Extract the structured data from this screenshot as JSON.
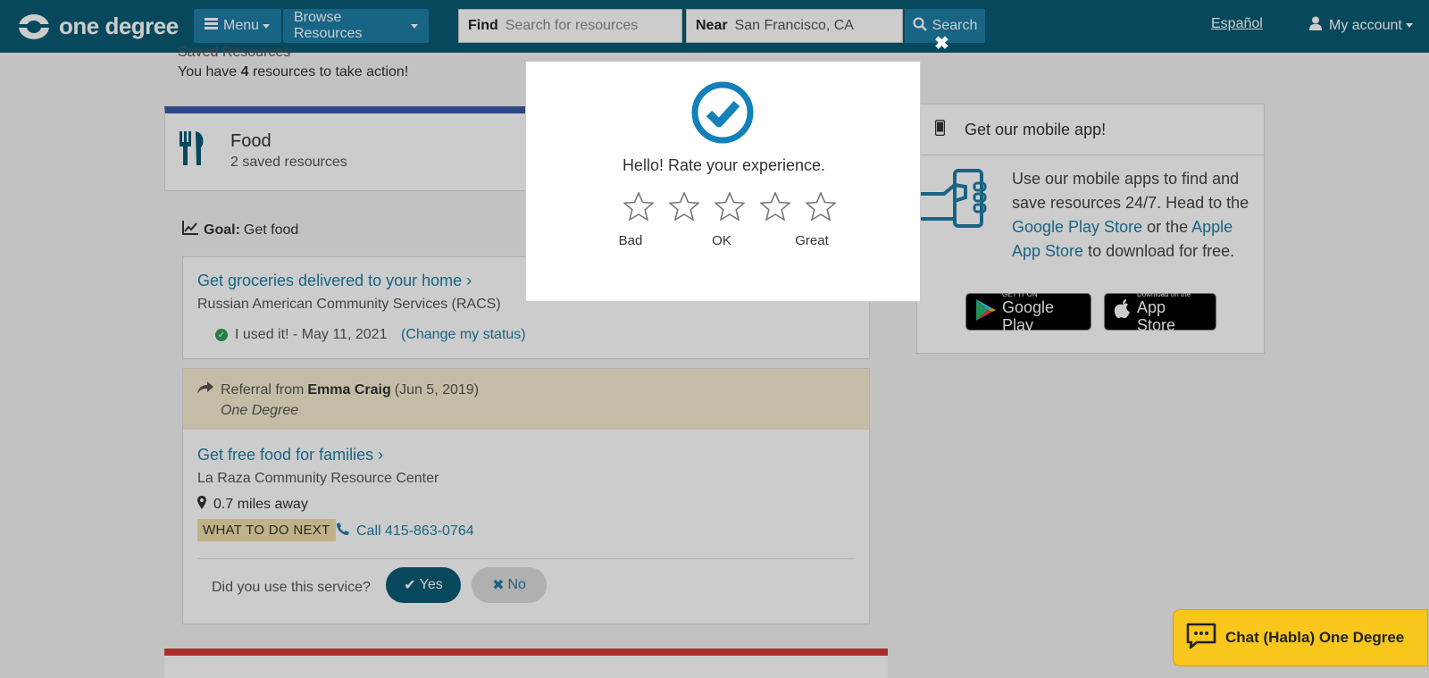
{
  "nav": {
    "logo_text": "one degree",
    "menu_label": "Menu",
    "browse_label": "Browse Resources",
    "find_label": "Find",
    "find_placeholder": "Search for resources",
    "near_label": "Near",
    "near_value": "San Francisco, CA",
    "search_label": "Search",
    "language_link": "Español",
    "account_label": "My account"
  },
  "saved": {
    "heading": "Saved Resources",
    "count_prefix": "You have",
    "count": "4",
    "count_suffix": "resources to take action!"
  },
  "category": {
    "title": "Food",
    "subtitle": "2 saved resources"
  },
  "goal": {
    "label": "Goal:",
    "value": "Get food"
  },
  "resource1": {
    "title": "Get groceries delivered to your home",
    "org": "Russian American Community Services (RACS)",
    "status": "I used it! - May 11, 2021",
    "change_status": "(Change my status)"
  },
  "resource2": {
    "referral_prefix": "Referral from",
    "referrer": "Emma Craig",
    "referral_date": "(Jun 5, 2019)",
    "referral_org": "One Degree",
    "title": "Get free food for families",
    "org": "La Raza Community Resource Center",
    "distance": "0.7 miles away",
    "next_label": "WHAT TO DO NEXT",
    "call_label": "Call 415-863-0764",
    "question": "Did you use this service?",
    "yes_label": "Yes",
    "no_label": "No"
  },
  "app_panel": {
    "title": "Get our mobile app!",
    "text_before": "Use our mobile apps to find and save resources 24/7. Head to the",
    "google_link": "Google Play Store",
    "text_mid": "or the",
    "apple_link": "Apple App Store",
    "text_after": "to download for free.",
    "google_small": "GET IT ON",
    "google_big": "Google Play",
    "apple_small": "Download on the",
    "apple_big": "App Store"
  },
  "modal": {
    "title": "Hello! Rate your experience.",
    "close_glyph": "✖",
    "rating_labels": {
      "bad": "Bad",
      "ok": "OK",
      "great": "Great"
    }
  },
  "chat": {
    "label": "Chat (Habla) One Degree"
  },
  "colors": {
    "nav_bg": "#0b5a73",
    "accent": "#1f7ea6",
    "food_bar": "#3b59a8",
    "chat_bg": "#f9c61b"
  }
}
